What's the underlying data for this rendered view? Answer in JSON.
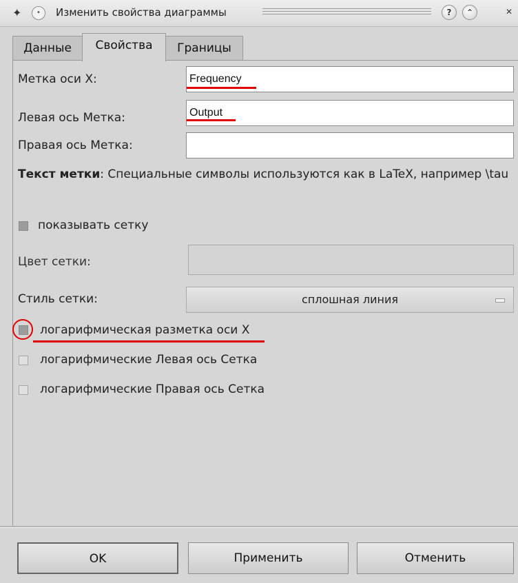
{
  "window": {
    "title": "Изменить свойства диаграммы"
  },
  "icons": {
    "app": "app-bird-icon",
    "menu": "window-menu-icon",
    "help": "help-icon",
    "minimize": "minimize-icon",
    "close": "close-icon"
  },
  "tabs": [
    {
      "label": "Данные",
      "active": false
    },
    {
      "label": "Свойства",
      "active": true
    },
    {
      "label": "Границы",
      "active": false
    }
  ],
  "fields": {
    "x_axis_label": {
      "label": "Метка оси X:",
      "value": "Frequency"
    },
    "left_axis_label": {
      "label": "Левая ось Метка:",
      "value": "Output"
    },
    "right_axis_label": {
      "label": "Правая ось Метка:",
      "value": ""
    }
  },
  "note": {
    "bold": "Текст метки",
    "text": ": Специальные символы используются как в LaTeX, например \\tau"
  },
  "grid": {
    "show_label": "показывать сетку",
    "show_checked": false,
    "color_label": "Цвет сетки:",
    "style_label": "Стиль сетки:",
    "style_value": "сплошная линия"
  },
  "log": {
    "x_label": "логарифмическая разметка оси X",
    "left_label": "логарифмические Левая ось Сетка",
    "right_label": "логарифмические Правая ось Сетка"
  },
  "buttons": {
    "ok": "OK",
    "apply": "Применить",
    "cancel": "Отменить"
  },
  "colors": {
    "annotation": "#e00000",
    "background": "#d6d6d6"
  }
}
